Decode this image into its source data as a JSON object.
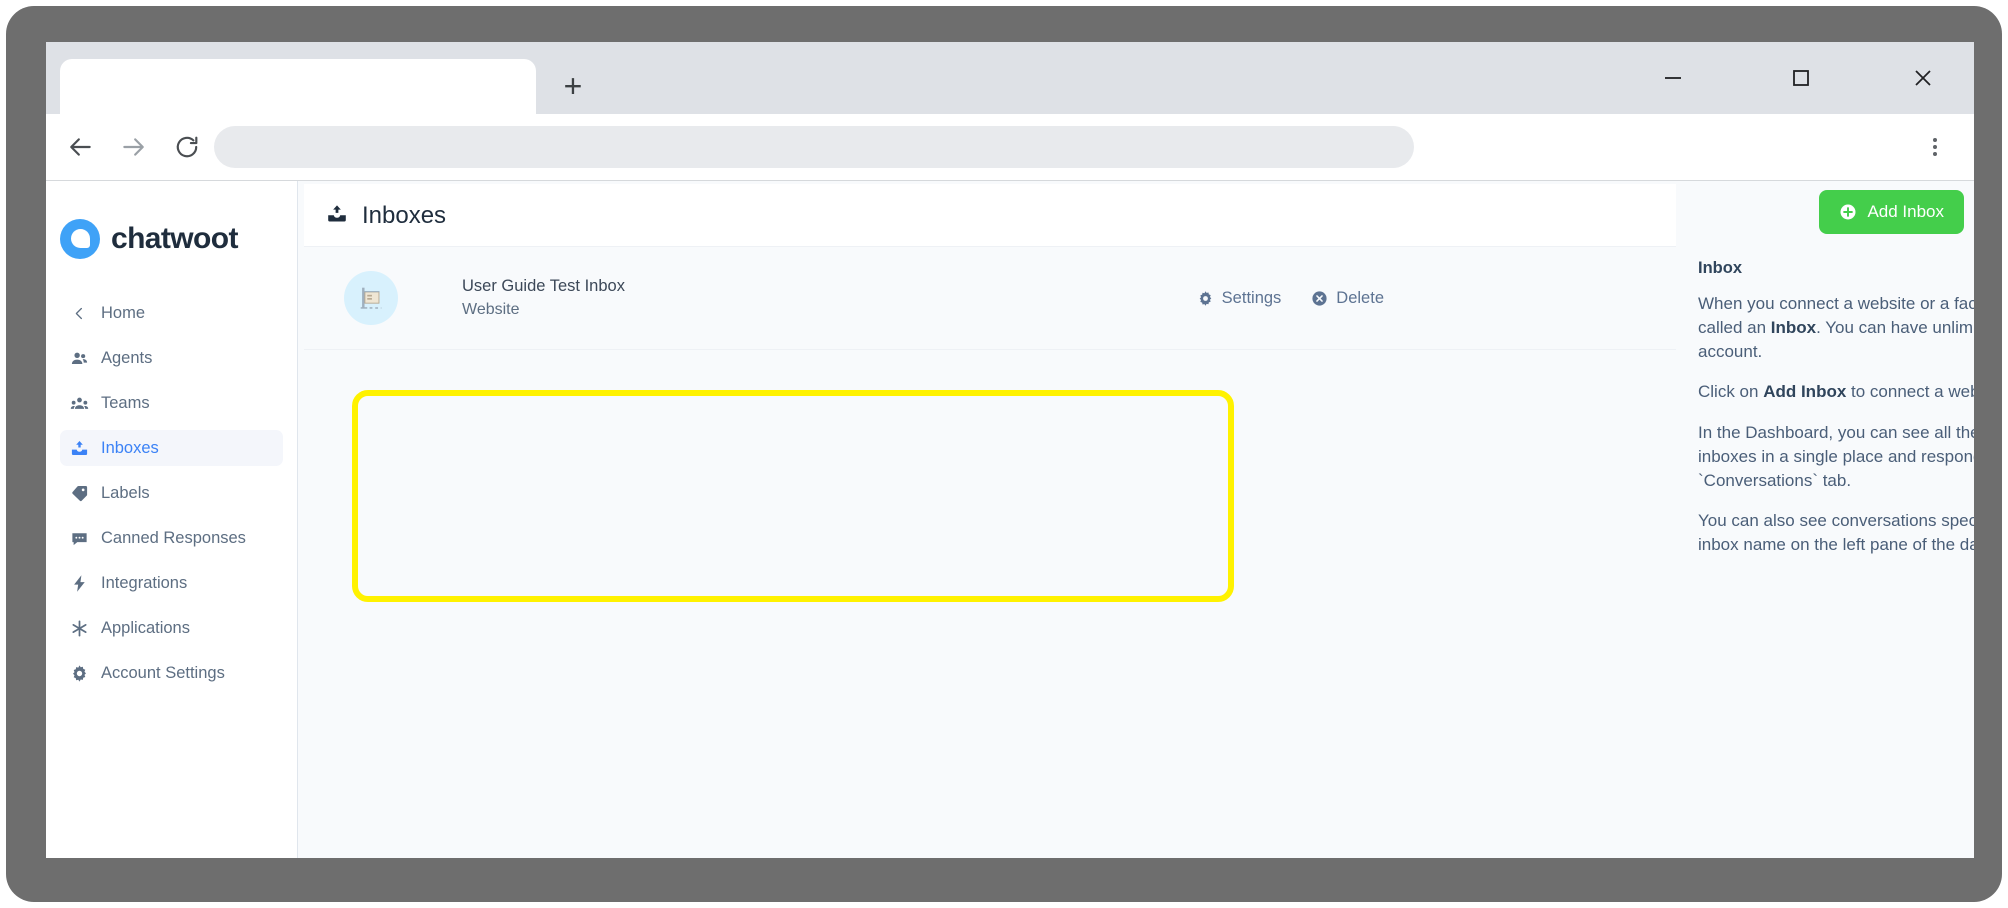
{
  "browser": {
    "tab_title": "",
    "new_tab_label": "+",
    "omnibox_value": "",
    "omnibox_placeholder": "",
    "window_controls": {
      "minimize": "minimize-icon",
      "maximize": "maximize-icon",
      "close": "close-icon"
    },
    "nav": {
      "back": "back-arrow-icon",
      "forward": "forward-arrow-icon",
      "reload": "reload-icon",
      "menu": "kebab-menu-icon"
    }
  },
  "sidebar": {
    "brand_name": "chatwoot",
    "items": [
      {
        "label": "Home",
        "icon": "chevron-left-icon",
        "active": false
      },
      {
        "label": "Agents",
        "icon": "agents-icon",
        "active": false
      },
      {
        "label": "Teams",
        "icon": "teams-icon",
        "active": false
      },
      {
        "label": "Inboxes",
        "icon": "inbox-icon",
        "active": true
      },
      {
        "label": "Labels",
        "icon": "label-tag-icon",
        "active": false
      },
      {
        "label": "Canned Responses",
        "icon": "chat-bubble-icon",
        "active": false
      },
      {
        "label": "Integrations",
        "icon": "lightning-bolt-icon",
        "active": false
      },
      {
        "label": "Applications",
        "icon": "asterisk-icon",
        "active": false
      },
      {
        "label": "Account Settings",
        "icon": "gear-icon",
        "active": false
      }
    ]
  },
  "main": {
    "title": "Inboxes",
    "title_icon": "inbox-icon",
    "add_inbox_label": "Add Inbox",
    "add_inbox_icon": "plus-circle-icon",
    "inboxes": [
      {
        "name": "User Guide Test Inbox",
        "channel": "Website",
        "avatar_icon": "website-signboard-icon",
        "actions": [
          {
            "label": "Settings",
            "icon": "gear-icon"
          },
          {
            "label": "Delete",
            "icon": "circle-x-icon"
          }
        ]
      }
    ]
  },
  "help": {
    "title": "Inbox",
    "paragraphs": [
      "When you connect a website or a facebook Page to Chatwoot, it is called an ",
      ". You can have unlimited inboxes in your Chatwoot account.",
      "Click on ",
      " to connect a website or a Facebook Page.",
      "In the Dashboard, you can see all the conversations from all your inboxes in a single place and respond to them under the `Conversations` tab.",
      "You can also see conversations specific to an inbox by clicking on the inbox name on the left pane of the dashboard."
    ],
    "bold_inbox": "Inbox",
    "bold_add_inbox": "Add Inbox"
  },
  "annotation": {
    "highlight_color": "#fff200",
    "target": "inboxes-panel"
  },
  "colors": {
    "accent_blue": "#3b82f6",
    "brand_blue": "#3fa2f7",
    "success_green": "#44ce4b",
    "highlight_yellow": "#fff200",
    "text_dark": "#1f2d3d",
    "text_muted": "#5d6e82"
  }
}
